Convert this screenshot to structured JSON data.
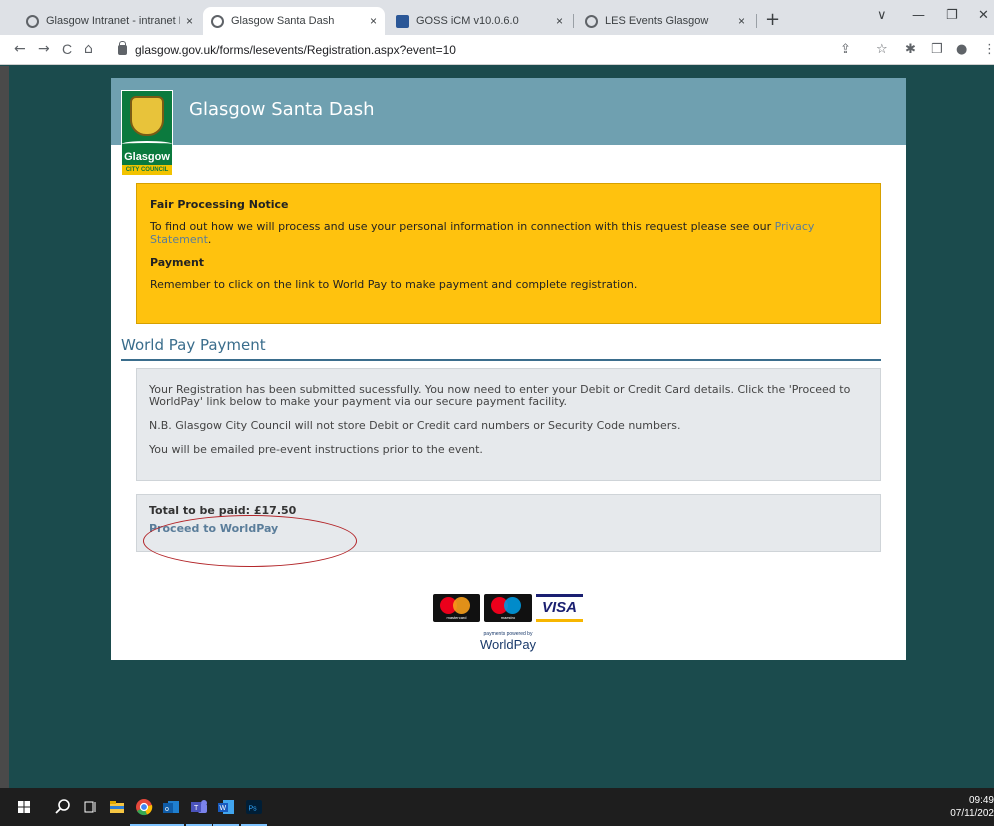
{
  "browser": {
    "tabs": [
      {
        "label": "Glasgow Intranet - intranet Hom",
        "active": false
      },
      {
        "label": "Glasgow Santa Dash",
        "active": true
      },
      {
        "label": "GOSS iCM v10.0.6.0",
        "active": false
      },
      {
        "label": "LES Events Glasgow",
        "active": false
      }
    ],
    "tab_close": "×",
    "new_tab": "+",
    "url": "glasgow.gov.uk/forms/lesevents/Registration.aspx?event=10",
    "window_controls": [
      "∨",
      "—",
      "❐",
      "✕"
    ],
    "nav": {
      "back": "←",
      "forward": "→",
      "reload": "C",
      "home": "⌂"
    },
    "toolbar_icons": [
      "⇪",
      "☆",
      "✱",
      "❒",
      "●",
      "⋮"
    ]
  },
  "site": {
    "title": "Glasgow Santa Dash",
    "logo_name": "Glasgow",
    "logo_sub": "CITY COUNCIL"
  },
  "notice": {
    "fair_title": "Fair Processing Notice",
    "fair_text": "To find out how we will process and use your personal information in connection with this request please see our",
    "privacy_link": "Privacy Statement",
    "fair_end": ".",
    "payment_title": "Payment",
    "payment_text": "Remember to click on the link to World Pay to make payment and complete registration."
  },
  "worldpay": {
    "heading": "World Pay Payment",
    "para1": "Your Registration has been submitted sucessfully. You now need to enter your Debit or Credit Card details. Click the 'Proceed to WorldPay' link below to make your payment via our secure payment facility.",
    "para2": "N.B. Glasgow City Council will not store Debit or Credit card numbers or Security Code numbers.",
    "para3": "You will be emailed pre-event instructions prior to the event.",
    "total": "Total to be paid: £17.50",
    "proceed": "Proceed to WorldPay"
  },
  "payment_logos": {
    "mastercard": "mastercard",
    "maestro": "maestro",
    "visa": "VISA",
    "powered_by": "payments powered by",
    "worldpay": "WorldPay"
  },
  "taskbar": {
    "time": "09:49",
    "date": "07/11/202"
  },
  "colors": {
    "page_bg": "#1b4b4d",
    "header": "#6fa0b0",
    "notice": "#ffc20e",
    "link": "#5a7d9a",
    "annotation": "#b3262a"
  }
}
